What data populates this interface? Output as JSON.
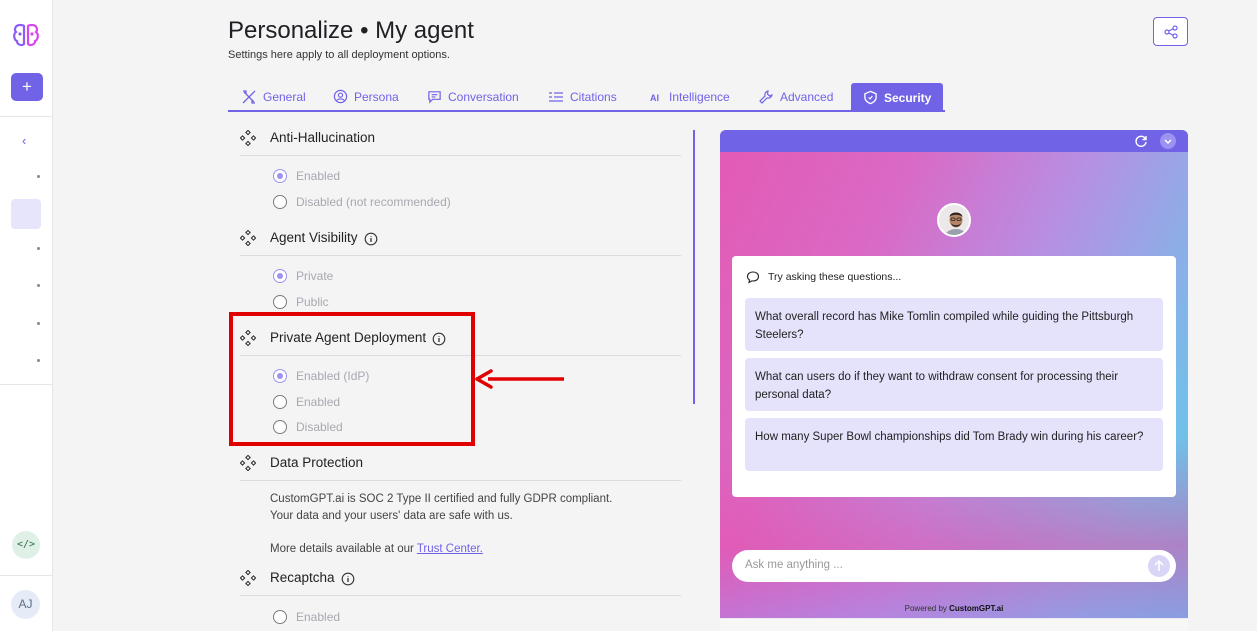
{
  "header": {
    "title": "Personalize • My agent",
    "subtitle": "Settings here apply to all deployment options."
  },
  "tabs": [
    {
      "label": "General",
      "icon": "tools-icon"
    },
    {
      "label": "Persona",
      "icon": "user-circle-icon"
    },
    {
      "label": "Conversation",
      "icon": "chat-icon"
    },
    {
      "label": "Citations",
      "icon": "quote-icon"
    },
    {
      "label": "Intelligence",
      "icon": "ai-icon"
    },
    {
      "label": "Advanced",
      "icon": "wrench-icon"
    },
    {
      "label": "Security",
      "icon": "shield-icon",
      "active": true
    }
  ],
  "sidebar": {
    "add_label": "+",
    "back_label": "‹",
    "code_label": "</>",
    "avatar_initials": "AJ"
  },
  "settings": {
    "anti_hallucination": {
      "title": "Anti-Hallucination",
      "options": [
        {
          "label": "Enabled",
          "checked": true
        },
        {
          "label": "Disabled (not recommended)",
          "checked": false
        }
      ]
    },
    "agent_visibility": {
      "title": "Agent Visibility",
      "options": [
        {
          "label": "Private",
          "checked": true
        },
        {
          "label": "Public",
          "checked": false
        }
      ]
    },
    "private_deployment": {
      "title": "Private Agent Deployment",
      "options": [
        {
          "label": "Enabled (IdP)",
          "checked": true
        },
        {
          "label": "Enabled",
          "checked": false
        },
        {
          "label": "Disabled",
          "checked": false
        }
      ]
    },
    "data_protection": {
      "title": "Data Protection",
      "line1": "CustomGPT.ai is SOC 2 Type II certified and fully GDPR compliant.",
      "line2": "Your data and your users' data are safe with us.",
      "more_prefix": "More details available at our ",
      "link": "Trust Center.",
      "more_suffix": ""
    },
    "recaptcha": {
      "title": "Recaptcha",
      "options": [
        {
          "label": "Enabled",
          "checked": false
        }
      ]
    }
  },
  "preview": {
    "prompt_header": "Try asking these questions...",
    "questions": [
      "What overall record has Mike Tomlin compiled while guiding the Pittsburgh Steelers?",
      "What can users do if they want to withdraw consent for processing their personal data?",
      "How many Super Bowl championships did Tom Brady win during his career?"
    ],
    "input_placeholder": "Ask me anything ...",
    "powered_prefix": "Powered by ",
    "powered_brand": "CustomGPT.ai"
  },
  "colors": {
    "accent": "#7063e6",
    "highlight": "#e00000"
  }
}
